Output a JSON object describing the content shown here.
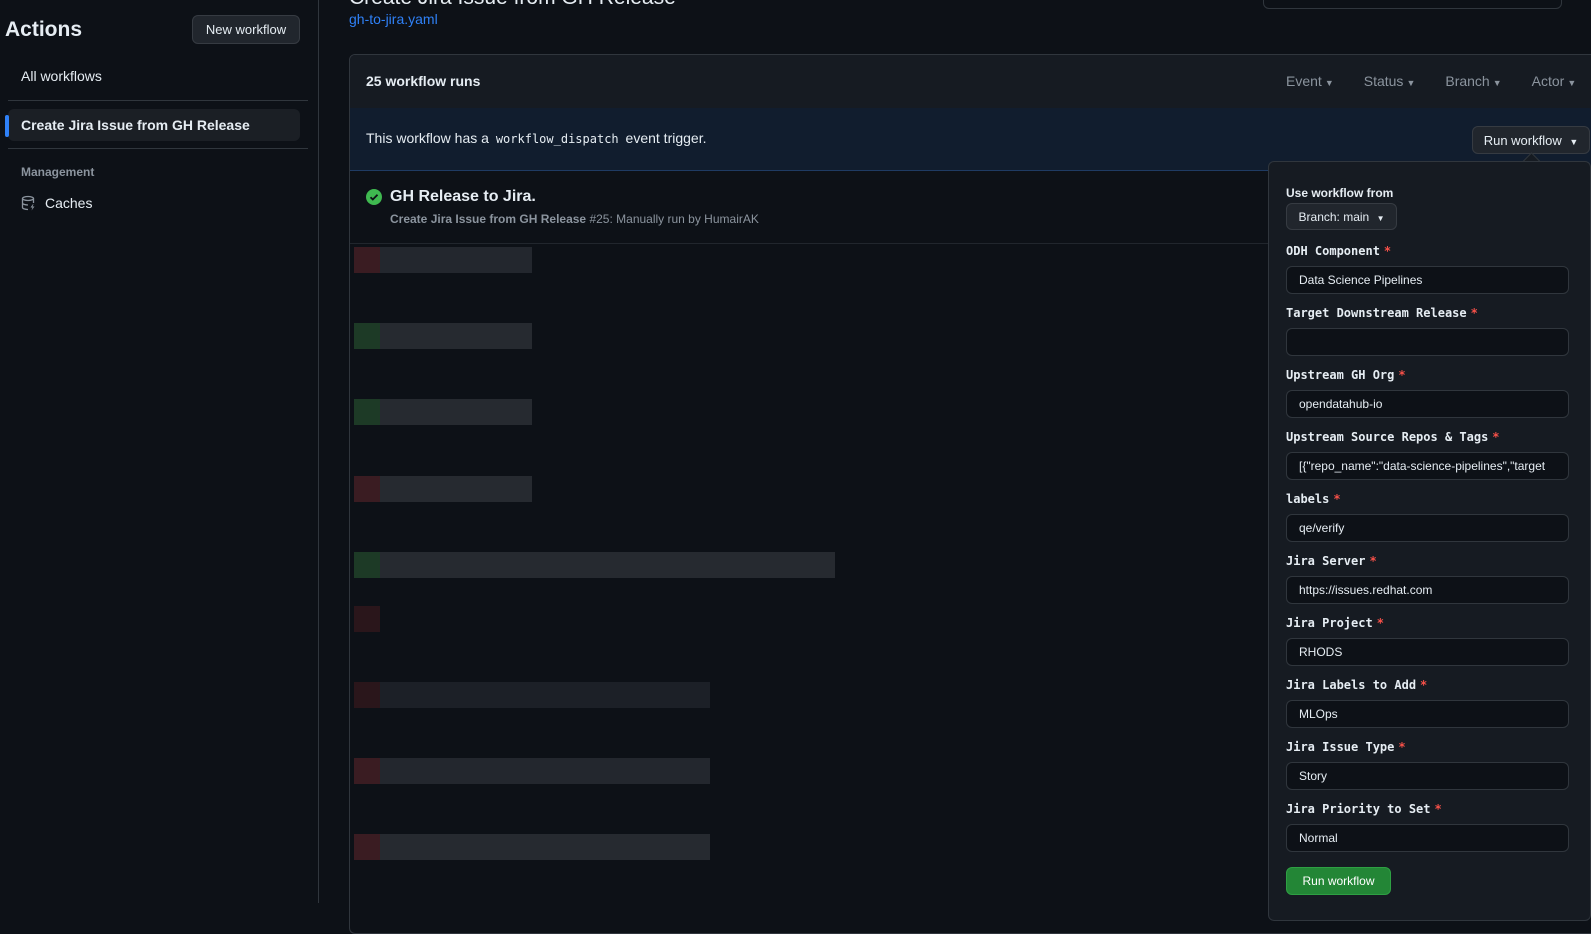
{
  "sidebar": {
    "title": "Actions",
    "new_workflow_label": "New workflow",
    "all_workflows_label": "All workflows",
    "active_workflow_label": "Create Jira Issue from GH Release",
    "management_heading": "Management",
    "caches_label": "Caches"
  },
  "header": {
    "title": "Create Jira Issue from GH Release",
    "file_link": "gh-to-jira.yaml"
  },
  "runs": {
    "count_label": "25 workflow runs",
    "filters": [
      "Event",
      "Status",
      "Branch",
      "Actor"
    ],
    "dispatch_prefix": "This workflow has a",
    "dispatch_code": "workflow_dispatch",
    "dispatch_suffix": "event trigger.",
    "run_workflow_button": "Run workflow",
    "first_run": {
      "title": "GH Release to Jira.",
      "workflow_name": "Create Jira Issue from GH Release",
      "details": "#25: Manually run by HumairAK",
      "status": "success"
    }
  },
  "dropdown": {
    "use_workflow_from": "Use workflow from",
    "branch_label": "Branch: main",
    "fields": [
      {
        "label": "ODH Component",
        "value": "Data Science Pipelines"
      },
      {
        "label": "Target Downstream Release",
        "value": ""
      },
      {
        "label": "Upstream GH Org",
        "value": "opendatahub-io"
      },
      {
        "label": "Upstream Source Repos & Tags",
        "value": "[{\"repo_name\":\"data-science-pipelines\",\"target"
      },
      {
        "label": "labels",
        "value": "qe/verify"
      },
      {
        "label": "Jira Server",
        "value": "https://issues.redhat.com"
      },
      {
        "label": "Jira Project",
        "value": "RHODS"
      },
      {
        "label": "Jira Labels to Add",
        "value": "MLOps"
      },
      {
        "label": "Jira Issue Type",
        "value": "Story"
      },
      {
        "label": "Jira Priority to Set",
        "value": "Normal"
      }
    ],
    "required_marker": "*",
    "submit_label": "Run workflow"
  },
  "colors": {
    "background": "#0d1117",
    "accent": "#2f81f7",
    "success": "#3fb950",
    "primary_button": "#238636",
    "required": "#f85149"
  }
}
